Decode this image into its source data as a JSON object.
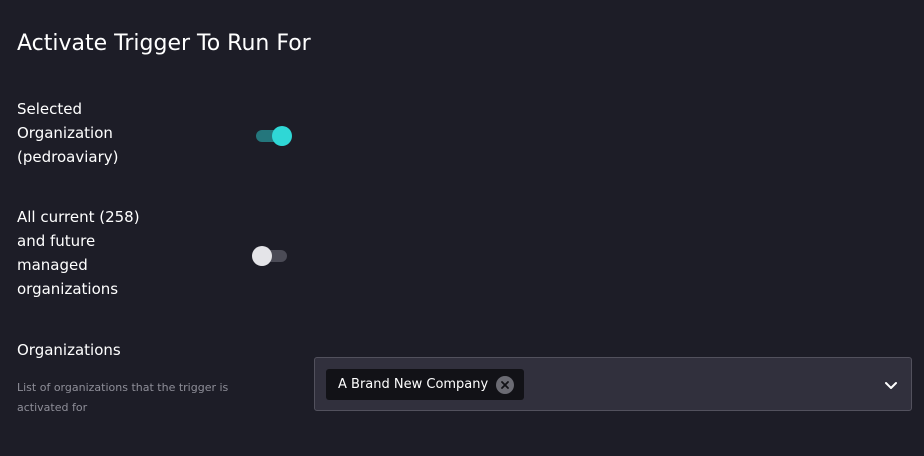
{
  "page": {
    "title": "Activate Trigger To Run For"
  },
  "toggles": [
    {
      "label_lines": [
        "Selected",
        "Organization",
        "(pedroaviary)"
      ],
      "state": "on"
    },
    {
      "label_lines": [
        "All current (258)",
        "and future",
        "managed",
        "organizations"
      ],
      "state": "off"
    }
  ],
  "organizations": {
    "label": "Organizations",
    "description": "List of organizations that the trigger is activated for",
    "selected": [
      {
        "label": "A Brand New Company"
      }
    ]
  },
  "icons": {
    "remove": "close-circle-icon",
    "dropdown": "chevron-down-icon"
  },
  "colors": {
    "background": "#1d1d27",
    "toggle_on_knob": "#2fd7d6",
    "toggle_on_track": "#24767c",
    "toggle_off_knob": "#e4e4e8",
    "toggle_off_track": "#4b4b56",
    "select_background": "#31303d",
    "chip_background": "#121217"
  }
}
